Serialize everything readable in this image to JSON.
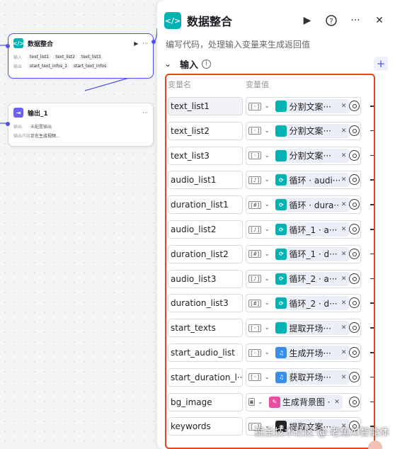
{
  "canvas": {
    "code_node": {
      "title": "数据整合",
      "input_label": "输入",
      "inputs": [
        "text_list1",
        "text_list2",
        "text_list3"
      ],
      "output_label": "输出",
      "outputs": [
        "start_text_infos_1",
        "start_text_infos"
      ],
      "more": "···"
    },
    "output_node": {
      "title": "输出_1",
      "row1_label": "输出",
      "row1_value": "未配置输出",
      "row2_label": "输出内容",
      "row2_value": "正在生成视频...",
      "more": "···"
    }
  },
  "panel": {
    "title": "数据整合",
    "description": "编写代码，处理输入变量来生成返回值",
    "section_title": "输入",
    "col_name": "变量名",
    "col_value": "变量值",
    "rows": [
      {
        "name": "text_list1",
        "type": "[◦]",
        "ref": "分割文案···",
        "icon": "code",
        "grey": true
      },
      {
        "name": "text_list2",
        "type": "[◦]",
        "ref": "分割文案···",
        "icon": "code",
        "grey": false
      },
      {
        "name": "text_list3",
        "type": "[◦]",
        "ref": "分割文案···",
        "icon": "code",
        "grey": false
      },
      {
        "name": "audio_list1",
        "type": "[♪]",
        "ref": "循环 · audi···",
        "icon": "loop",
        "grey": false
      },
      {
        "name": "duration_list1",
        "type": "[#]",
        "ref": "循环 · dura···",
        "icon": "loop",
        "grey": false
      },
      {
        "name": "audio_list2",
        "type": "[♪]",
        "ref": "循环_1 · a···",
        "icon": "loop",
        "grey": false
      },
      {
        "name": "duration_list2",
        "type": "[#]",
        "ref": "循环_1 · d···",
        "icon": "loop",
        "grey": false
      },
      {
        "name": "audio_list3",
        "type": "[♪]",
        "ref": "循环_2 · a···",
        "icon": "loop",
        "grey": false
      },
      {
        "name": "duration_list3",
        "type": "[#]",
        "ref": "循环_2 · d···",
        "icon": "loop",
        "grey": false
      },
      {
        "name": "start_texts",
        "type": "[◦]",
        "ref": "提取开场···",
        "icon": "code",
        "grey": false
      },
      {
        "name": "start_audio_list",
        "type": "[◦]",
        "ref": "生成开场···",
        "icon": "audio",
        "grey": false
      },
      {
        "name": "start_duration_l···",
        "type": "[◦]",
        "ref": "获取开场···",
        "icon": "audio",
        "grey": false
      },
      {
        "name": "bg_image",
        "type": "▣",
        "ref": "生成背景图 · ···",
        "icon": "image",
        "grey": false
      },
      {
        "name": "keywords",
        "type": "[◦]",
        "ref": "提取文案···",
        "icon": "llm",
        "grey": false
      }
    ]
  },
  "watermark": "掘金技术社区 @ 老鱼AI智能体",
  "colors": {
    "accent": "#4d53e8",
    "code": "#00b2b2",
    "loop": "#00b2b2",
    "highlight": "#e0481f"
  }
}
